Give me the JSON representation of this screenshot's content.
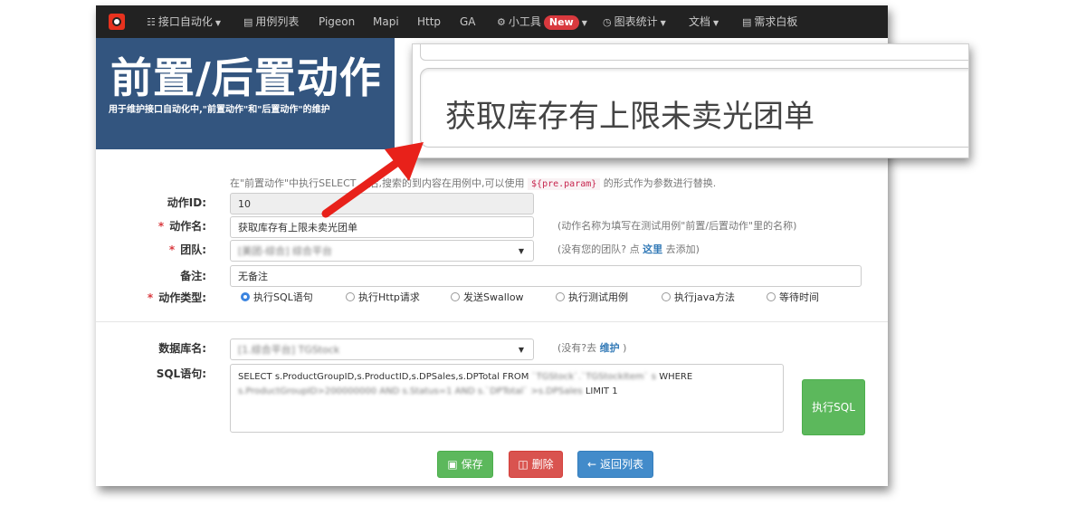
{
  "nav": {
    "items": [
      {
        "label": "接口自动化",
        "icon": "book-icon"
      },
      {
        "label": "用例列表",
        "icon": "list-icon"
      },
      {
        "label": "Pigeon"
      },
      {
        "label": "Mapi"
      },
      {
        "label": "Http"
      },
      {
        "label": "GA"
      },
      {
        "label": "小工具",
        "icon": "gear-icon",
        "badge": "New"
      },
      {
        "label": "图表统计",
        "icon": "dashboard-icon"
      },
      {
        "label": "文档"
      },
      {
        "label": "需求白板",
        "icon": "board-icon"
      }
    ]
  },
  "header": {
    "title": "前置/后置动作",
    "subtitle": "用于维护接口自动化中,\"前置动作\"和\"后置动作\"的维护"
  },
  "zoom": {
    "text": "获取库存有上限未卖光团单"
  },
  "form": {
    "hint_prefix": "在\"前置动作\"中执行SELECT",
    "hint_mid": "后,搜索的到内容在用例中,可以使用",
    "hint_code": "${pre.param}",
    "hint_suffix": "的形式作为参数进行替换.",
    "id_label": "动作ID:",
    "id_value": "10",
    "name_label": "动作名:",
    "name_value": "获取库存有上限未卖光团单",
    "name_note": "(动作名称为填写在测试用例\"前置/后置动作\"里的名称)",
    "team_label": "团队:",
    "team_value": "[美团-综合] 综合平台",
    "team_note_prefix": "(没有您的团队? 点",
    "team_note_link": "这里",
    "team_note_suffix": "去添加)",
    "remark_label": "备注:",
    "remark_value": "无备注",
    "type_label": "动作类型:",
    "types": [
      "执行SQL语句",
      "执行Http请求",
      "发送Swallow",
      "执行测试用例",
      "执行java方法",
      "等待时间"
    ],
    "selected_type": "执行SQL语句",
    "db_label": "数据库名:",
    "db_value": "[1.综合平台] TGStock",
    "db_note_prefix": "(没有?去",
    "db_note_link": "维护",
    "db_note_suffix": ")",
    "sql_label": "SQL语句:",
    "sql_line1": "SELECT s.ProductGroupID,s.ProductID,s.DPSales,s.DPTotal FROM",
    "sql_line1_blur": "`TGStock`.`TGStockItem` s",
    "sql_line1_end": "WHERE",
    "sql_line2_blur": "s.ProductGroupID>200000000 AND s.Status=1 AND s.`DPTotal` >s.DPSales",
    "sql_line2_end": "LIMIT 1",
    "exec_sql_button": "执行SQL",
    "save_button": "保存",
    "delete_button": "删除",
    "back_button": "返回列表"
  },
  "colors": {
    "navbar": "#222222",
    "jumbotron": "#33557f",
    "arrow": "#e8211a",
    "success": "#5cb85c",
    "danger": "#d9534f",
    "primary": "#428bca",
    "radio_checked": "#3b84e0"
  }
}
